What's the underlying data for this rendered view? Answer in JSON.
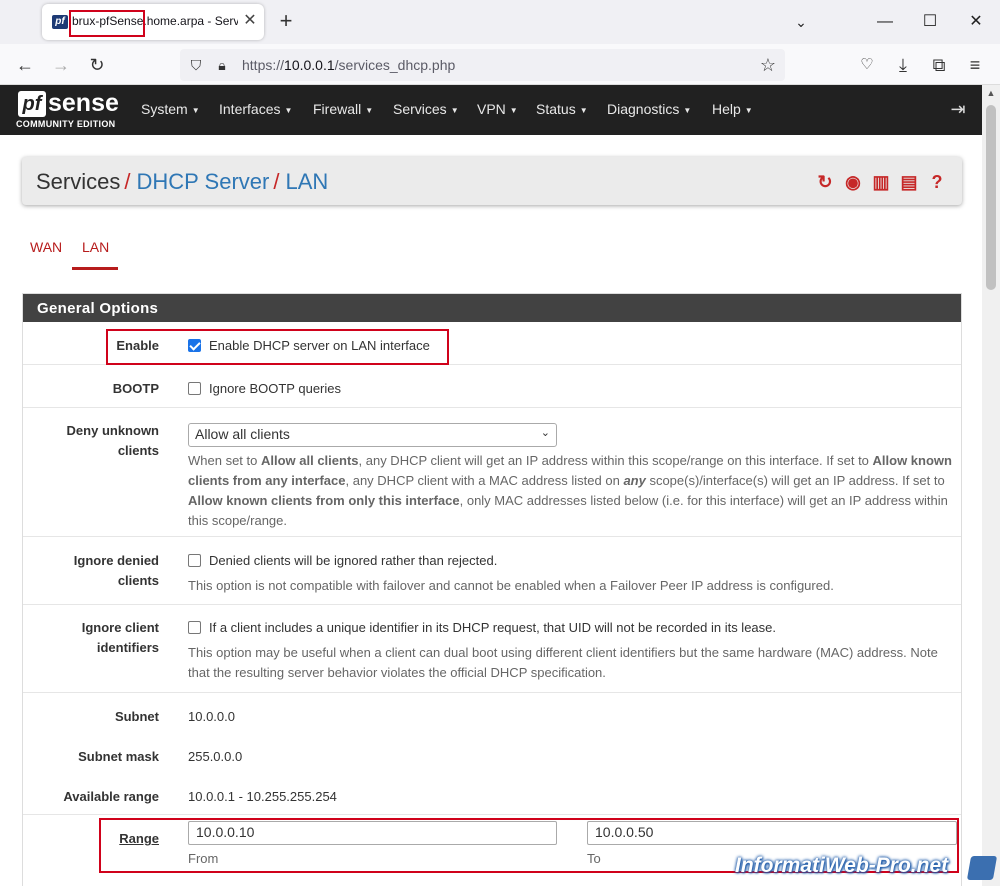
{
  "browser": {
    "tab_favicon_text": "pf",
    "tab_title": "brux-pfSense.home.arpa - Servi",
    "tab_close": "✕",
    "new_tab": "+",
    "minimize": "—",
    "maximize": "☐",
    "close": "✕",
    "url_prefix": "https://",
    "url_host": "10.0.0.1",
    "url_path": "/services_dhcp.php"
  },
  "pfsense": {
    "logo_pf": "pf",
    "logo_sense": "sense",
    "logo_edition": "COMMUNITY EDITION",
    "menu": [
      "System",
      "Interfaces",
      "Firewall",
      "Services",
      "VPN",
      "Status",
      "Diagnostics",
      "Help"
    ]
  },
  "breadcrumb": {
    "root": "Services",
    "section": "DHCP Server",
    "page": "LAN"
  },
  "tabs": [
    "WAN",
    "LAN"
  ],
  "panel": {
    "heading": "General Options",
    "enable": {
      "label": "Enable",
      "checkbox_label": "Enable DHCP server on LAN interface",
      "checked": true
    },
    "bootp": {
      "label": "BOOTP",
      "checkbox_label": "Ignore BOOTP queries",
      "checked": false
    },
    "deny_unknown": {
      "label_line1": "Deny unknown",
      "label_line2": "clients",
      "selected": "Allow all clients",
      "help_1": "When set to ",
      "help_b1": "Allow all clients",
      "help_2": ", any DHCP client will get an IP address within this scope/range on this interface. If set to ",
      "help_b2": "Allow known clients from any interface",
      "help_3": ", any DHCP client with a MAC address listed on ",
      "help_b3": "any",
      "help_4": " scope(s)/interface(s) will get an IP address. If set to ",
      "help_b4": "Allow known clients from only this interface",
      "help_5": ", only MAC addresses listed below (i.e. for this interface) will get an IP address within this scope/range."
    },
    "ignore_denied": {
      "label_line1": "Ignore denied",
      "label_line2": "clients",
      "checkbox_label": "Denied clients will be ignored rather than rejected.",
      "help": "This option is not compatible with failover and cannot be enabled when a Failover Peer IP address is configured."
    },
    "ignore_client_ids": {
      "label_line1": "Ignore client",
      "label_line2": "identifiers",
      "checkbox_label": "If a client includes a unique identifier in its DHCP request, that UID will not be recorded in its lease.",
      "help": "This option may be useful when a client can dual boot using different client identifiers but the same hardware (MAC) address. Note that the resulting server behavior violates the official DHCP specification."
    },
    "subnet": {
      "label": "Subnet",
      "value": "10.0.0.0"
    },
    "subnet_mask": {
      "label": "Subnet mask",
      "value": "255.0.0.0"
    },
    "available_range": {
      "label": "Available range",
      "value": "10.0.0.1 - 10.255.255.254"
    },
    "range": {
      "label": "Range",
      "from_value": "10.0.0.10",
      "from_label": "From",
      "to_value": "10.0.0.50",
      "to_label": "To"
    }
  },
  "watermark": "InformatiWeb-Pro.net"
}
